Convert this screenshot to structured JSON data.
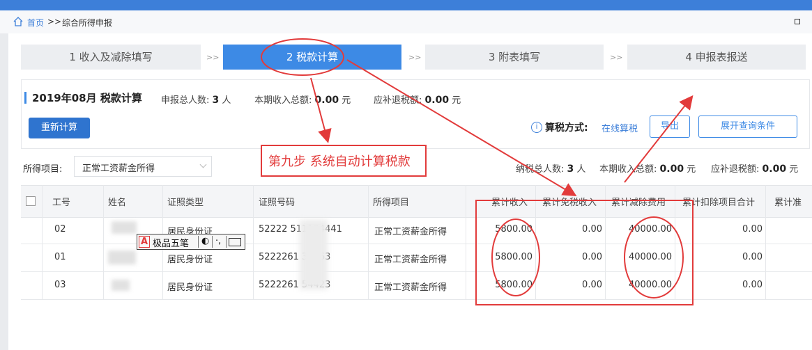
{
  "breadcrumb": {
    "home": "首页",
    "separator": ">>",
    "current": "综合所得申报"
  },
  "steps": [
    {
      "label": "1 收入及减除填写",
      "active": false
    },
    {
      "label": "2 税款计算",
      "active": true
    },
    {
      "label": "3 附表填写",
      "active": false
    },
    {
      "label": "4 申报表报送",
      "active": false
    }
  ],
  "step_arrow": ">>",
  "summary": {
    "period": "2019年08月",
    "title": "税款计算",
    "declare_count_label": "申报总人数:",
    "declare_count_value": "3",
    "declare_count_unit": "人",
    "income_label": "本期收入总额:",
    "income_value": "0.00",
    "income_unit": "元",
    "tax_label": "应补退税额:",
    "tax_value": "0.00",
    "tax_unit": "元",
    "recalc_button": "重新计算",
    "calc_method_label": "算税方式:",
    "calc_method_value": "在线算税",
    "export_button": "导出",
    "expand_button": "展开查询条件"
  },
  "filter": {
    "label": "所得项目:",
    "selected": "正常工资薪金所得",
    "taxpayer_count_label": "纳税总人数:",
    "taxpayer_count_value": "3",
    "taxpayer_count_unit": "人",
    "income_label": "本期收入总额:",
    "income_value": "0.00",
    "income_unit": "元",
    "tax_label": "应补退税额:",
    "tax_value": "0.00",
    "tax_unit": "元"
  },
  "annotation": "第九步  系统自动计算税款",
  "table": {
    "headers": [
      "工号",
      "姓名",
      "证照类型",
      "证照号码",
      "所得项目",
      "累计收入",
      "累计免税收入",
      "累计减除费用",
      "累计扣除项目合计",
      "累计准"
    ],
    "rows": [
      {
        "id": "02",
        "name": "",
        "id_type": "居民身份证",
        "id_no": "52222         511194441",
        "item": "正常工资薪金所得",
        "income": "5800.00",
        "exempt": "0.00",
        "deduct": "40000.00",
        "total_deduct": "0.00"
      },
      {
        "id": "01",
        "name": "",
        "id_type": "居民身份证",
        "id_no": "5222261        34463",
        "item": "正常工资薪金所得",
        "income": "5800.00",
        "exempt": "0.00",
        "deduct": "40000.00",
        "total_deduct": "0.00"
      },
      {
        "id": "03",
        "name": "",
        "id_type": "居民身份证",
        "id_no": "5222261        54423",
        "item": "正常工资薪金所得",
        "income": "5800.00",
        "exempt": "0.00",
        "deduct": "40000.00",
        "total_deduct": "0.00"
      }
    ]
  },
  "ime_toolbar": {
    "text": "极品五笔",
    "mode": "◐",
    "punct": "·,",
    "letter": "A"
  },
  "colors": {
    "accent": "#3d8ae5",
    "annotation": "#e23b3b"
  }
}
